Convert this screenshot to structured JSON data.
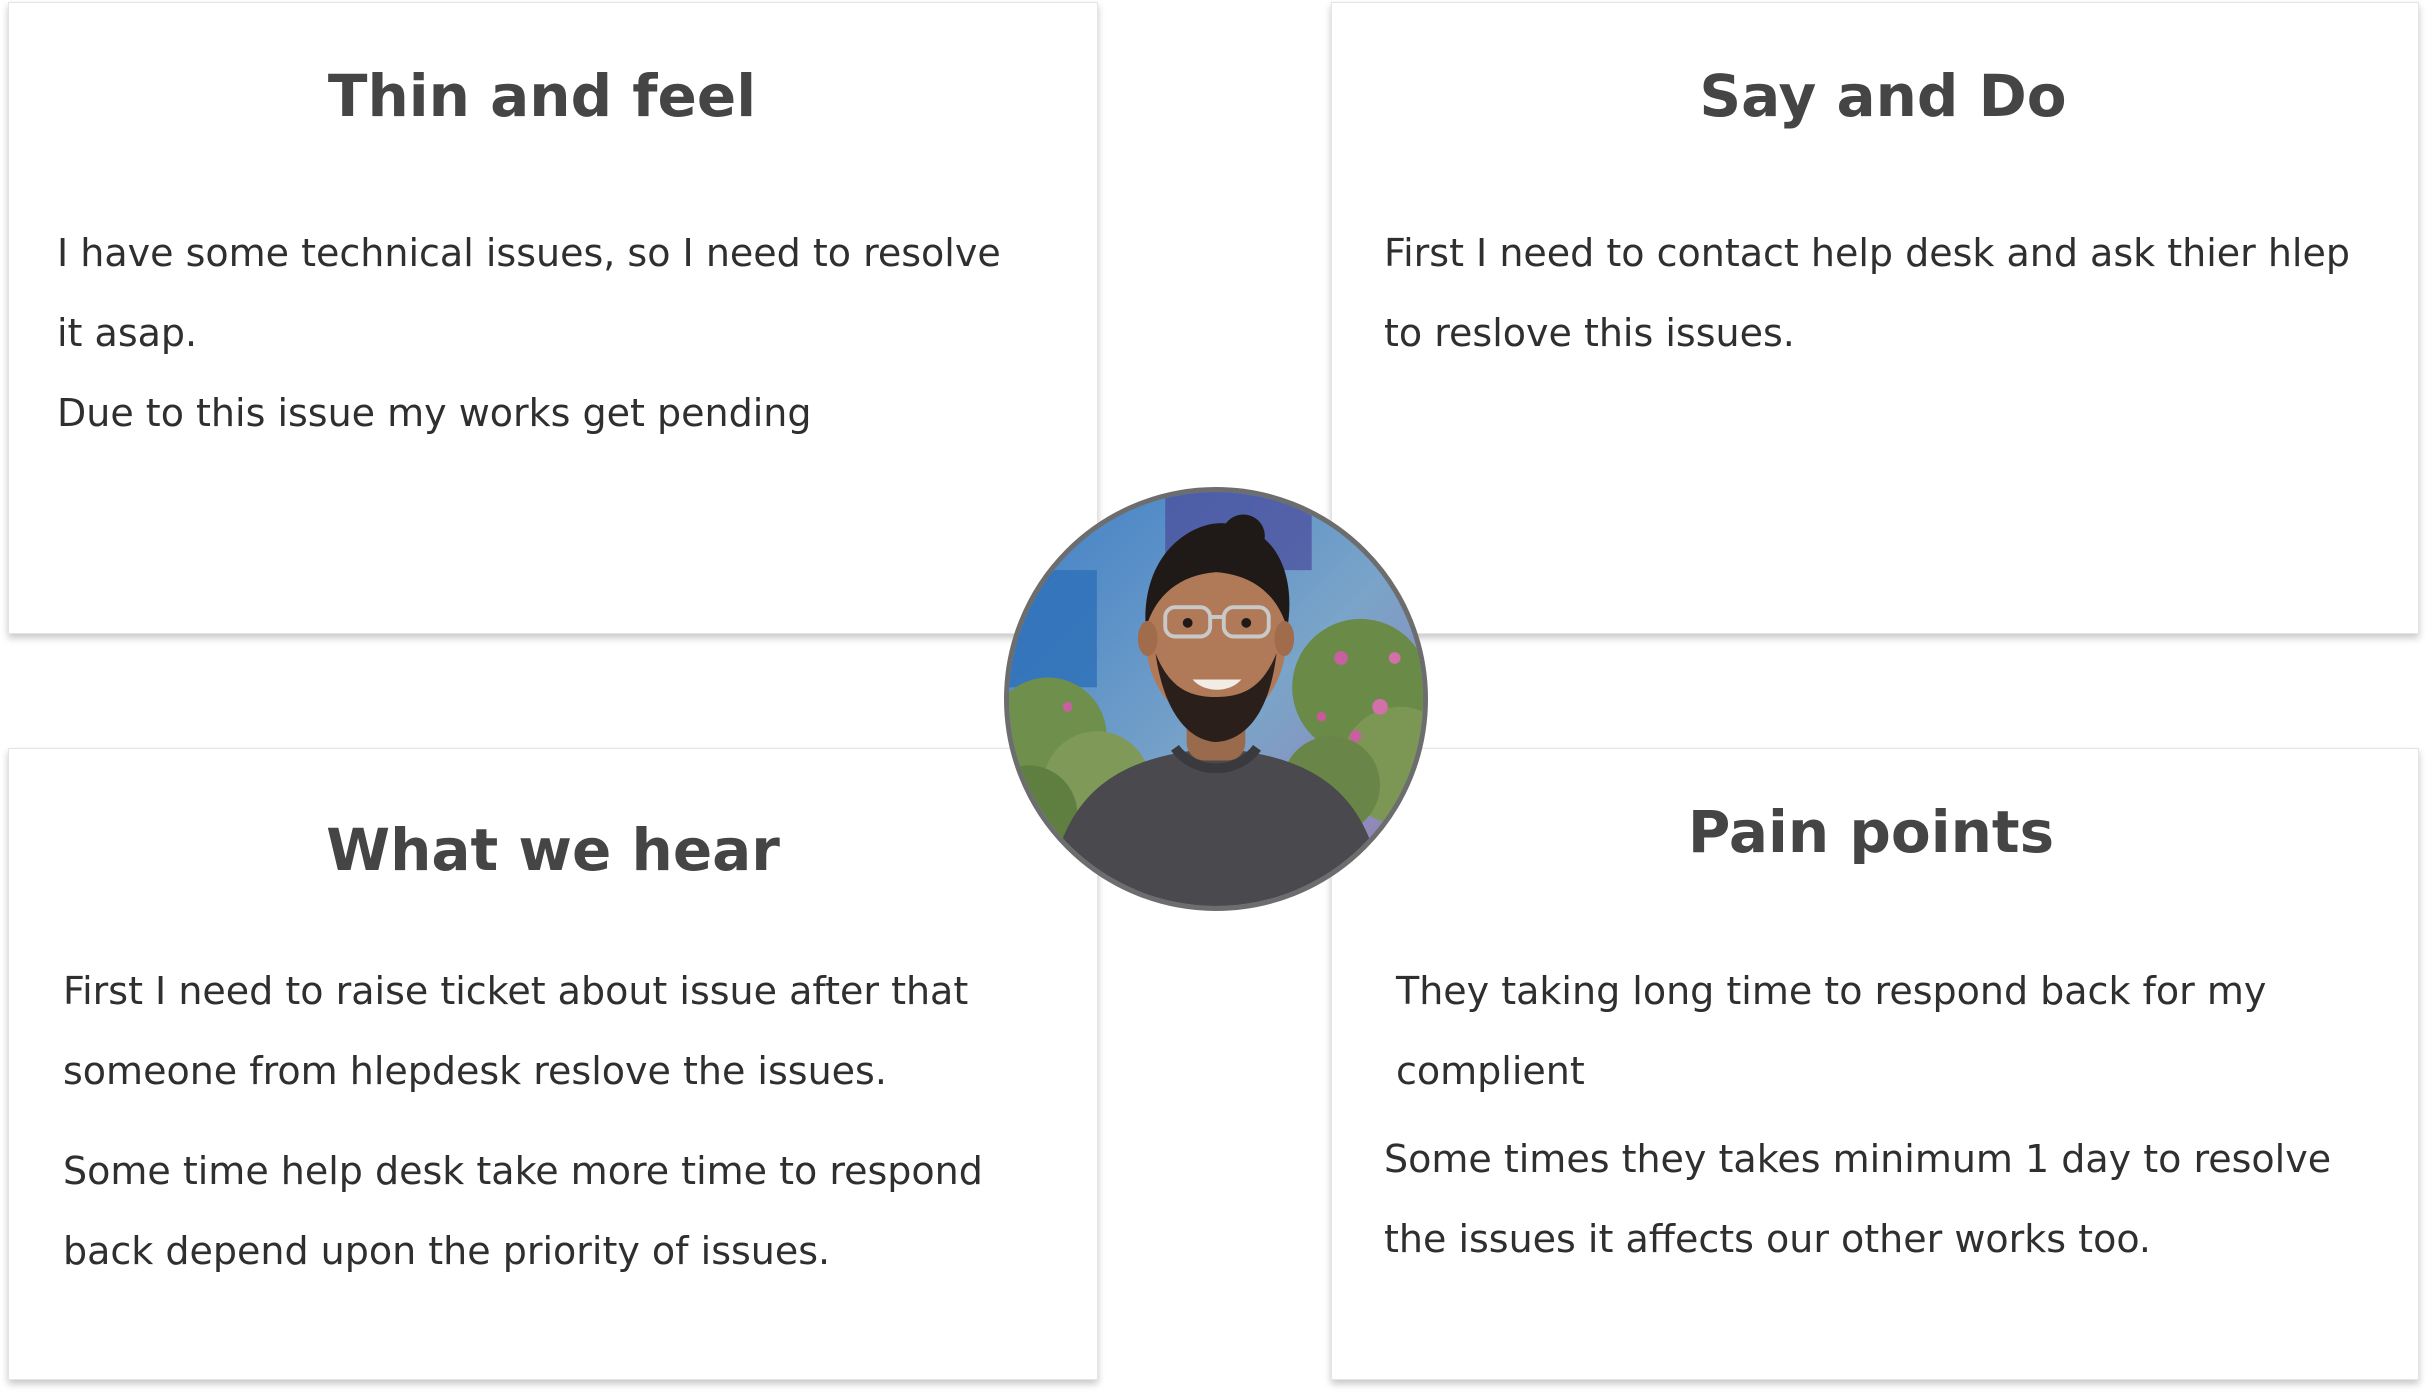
{
  "quadrants": {
    "think_feel": {
      "title": "Thin and feel",
      "lines": [
        "I have some technical issues, so I need to resolve",
        "it asap.",
        "Due to this issue my works get pending"
      ]
    },
    "say_do": {
      "title": "Say and Do",
      "lines": [
        "First I need to contact help desk and ask thier hlep",
        "to reslove this issues."
      ]
    },
    "hear": {
      "title": "What we hear",
      "lines": [
        "First I need to raise ticket about issue after that",
        "someone from hlepdesk reslove the issues.",
        "Some time help desk take more time to respond",
        "back depend upon the priority of issues."
      ]
    },
    "pain": {
      "title": "Pain points",
      "lines": [
        "They taking long time to respond back for my",
        "complient",
        "Some times they takes minimum 1 day to resolve",
        "the issues it affects our other works too."
      ]
    }
  },
  "persona": {
    "icon": "person-photo"
  },
  "colors": {
    "card_border": "#e4e4e4",
    "title_text": "#454545",
    "body_text": "#2f2f2f",
    "avatar_ring": "#6d6d6d"
  }
}
